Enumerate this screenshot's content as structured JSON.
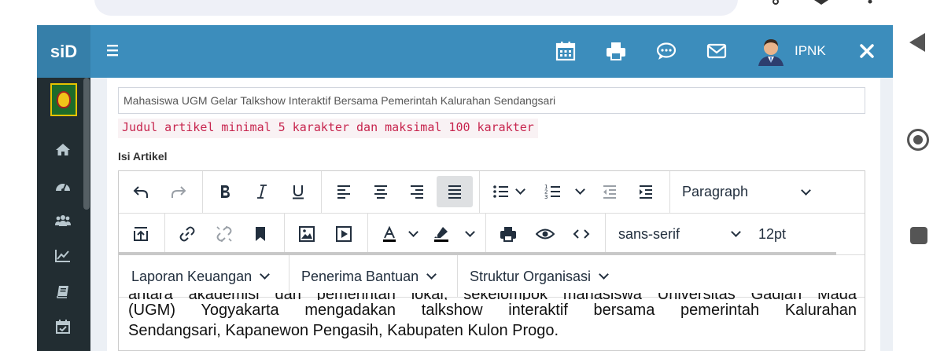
{
  "header": {
    "brand": "siD",
    "username": "IPNK",
    "icons": [
      "menu-icon",
      "calendar-icon",
      "print-icon",
      "comment-icon",
      "mail-icon",
      "user-avatar",
      "close-icon"
    ],
    "accent": "#3c8dbc"
  },
  "sidebar": {
    "icons": [
      "home-icon",
      "dashboard-icon",
      "users-icon",
      "chart-icon",
      "book-icon",
      "calendar-check-icon"
    ]
  },
  "article": {
    "title_value": "Mahasiswa UGM Gelar Talkshow Interaktif Bersama Pemerintah Kalurahan Sendangsari",
    "hint": "Judul artikel minimal 5 karakter dan maksimal 100 karakter",
    "body_label": "Isi Artikel"
  },
  "editor": {
    "block_format": "Paragraph",
    "font_family": "sans-serif",
    "font_size": "12pt",
    "custom_menus": [
      "Laporan Keuangan",
      "Penerima Bantuan",
      "Struktur Organisasi"
    ],
    "content_line_1": "antara akademisi dan pemerintah lokal, sekelompok mahasiswa Universitas Gadjah Mada",
    "content_line_2": "(UGM) Yogyakarta mengadakan talkshow interaktif bersama pemerintah Kalurahan",
    "content_line_3": "Sendangsari, Kapanewon Pengasih, Kabupaten Kulon Progo."
  }
}
